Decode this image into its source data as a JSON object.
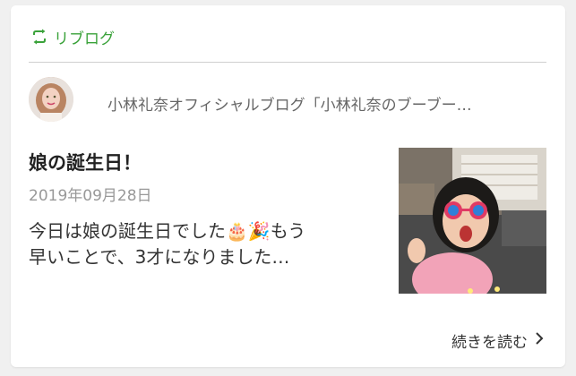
{
  "reblog": {
    "label": "リブログ",
    "icon": "reblog-icon",
    "color": "#3aa23a"
  },
  "blog": {
    "title": "小林礼奈オフィシャルブログ「小林礼奈のブーブー…"
  },
  "post": {
    "title": "娘の誕生日！",
    "date": "2019年09月28日",
    "excerpt_line1": "今日は娘の誕生日でした🎂🎉もう",
    "excerpt_line2": "早いことで、3才になりました…"
  },
  "read_more": {
    "label": "続きを読む",
    "icon": "chevron-right-icon"
  }
}
